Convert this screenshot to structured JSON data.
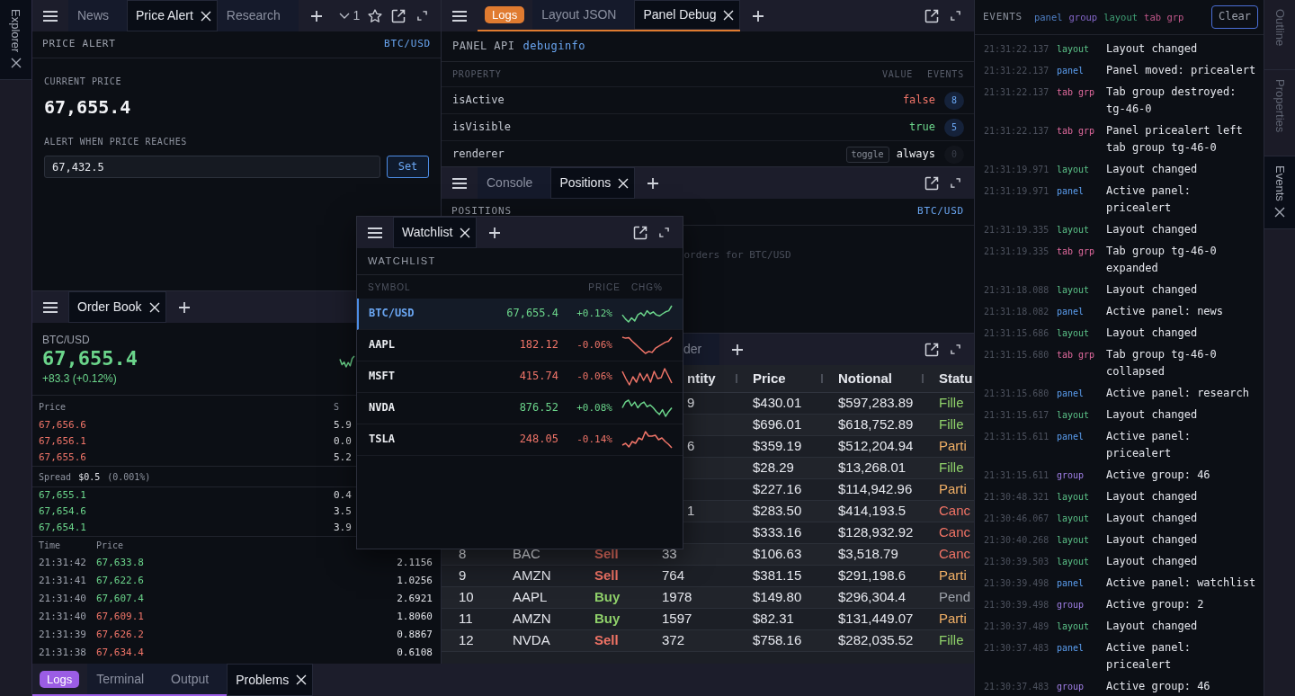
{
  "left_dock": {
    "tabs": [
      {
        "label": "Explorer",
        "selected": true
      }
    ]
  },
  "price_alert_group": {
    "tabs": [
      {
        "label": "News",
        "selected": false
      },
      {
        "label": "Price Alert",
        "selected": true
      },
      {
        "label": "Research",
        "selected": false
      }
    ],
    "hidden_tab_count": "1",
    "panel": {
      "title": "PRICE ALERT",
      "symbol": "BTC/USD",
      "current_price_label": "CURRENT PRICE",
      "current_price": "67,655.4",
      "alert_label": "ALERT WHEN PRICE REACHES",
      "alert_value": "67,432.5",
      "set_button": "Set"
    }
  },
  "order_book_group": {
    "tabs": [
      {
        "label": "Order Book",
        "selected": true
      }
    ],
    "panel": {
      "symbol": "BTC/USD",
      "price": "67,655.4",
      "change": "+83.3 (+0.12%)",
      "book_columns": [
        "Price",
        "S"
      ],
      "asks": [
        {
          "price": "67,656.6",
          "size": "5.9"
        },
        {
          "price": "67,656.1",
          "size": "0.0"
        },
        {
          "price": "67,655.6",
          "size": "5.2"
        }
      ],
      "spread": {
        "label": "Spread",
        "value": "$0.5",
        "percent": "(0.001%)"
      },
      "bids": [
        {
          "price": "67,655.1",
          "size": "0.4"
        },
        {
          "price": "67,654.6",
          "size": "3.5"
        },
        {
          "price": "67,654.1",
          "size": "3.9"
        }
      ],
      "trade_columns": [
        "Time",
        "Price"
      ],
      "trades": [
        {
          "time": "21:31:42",
          "price": "67,633.8",
          "size": "2.1156",
          "kind": "buy"
        },
        {
          "time": "21:31:41",
          "price": "67,622.6",
          "size": "1.0256",
          "kind": "buy"
        },
        {
          "time": "21:31:40",
          "price": "67,607.4",
          "size": "2.6921",
          "kind": "buy"
        },
        {
          "time": "21:31:40",
          "price": "67,609.1",
          "size": "1.8060",
          "kind": "sell"
        },
        {
          "time": "21:31:39",
          "price": "67,626.2",
          "size": "0.8867",
          "kind": "sell"
        },
        {
          "time": "21:31:38",
          "price": "67,634.4",
          "size": "0.6108",
          "kind": "sell"
        }
      ]
    }
  },
  "bottom_dock": {
    "tab_group": {
      "label": "Logs",
      "color": "#9b5de5",
      "tabs": [
        {
          "label": "Terminal",
          "selected": false
        },
        {
          "label": "Output",
          "selected": false
        }
      ]
    },
    "tabs": [
      {
        "label": "Problems",
        "selected": true
      }
    ]
  },
  "debug_group": {
    "tab_group": {
      "label": "Logs",
      "color": "#e07b30",
      "tabs": [
        {
          "label": "Layout JSON",
          "selected": false
        },
        {
          "label": "Panel Debug",
          "selected": true
        }
      ]
    },
    "panel": {
      "title": "PANEL API",
      "panel_id": "debuginfo",
      "columns": [
        "PROPERTY",
        "VALUE",
        "EVENTS"
      ],
      "properties": [
        {
          "name": "isActive",
          "value": "false",
          "kind": "negative",
          "events": "8",
          "events_active": true
        },
        {
          "name": "isVisible",
          "value": "true",
          "kind": "positive",
          "events": "5",
          "events_active": true
        },
        {
          "name": "renderer",
          "action": "toggle",
          "value": "always",
          "kind": "plain",
          "events": "0",
          "events_active": false
        }
      ]
    }
  },
  "positions_group": {
    "tabs": [
      {
        "label": "Console",
        "selected": false
      },
      {
        "label": "Positions",
        "selected": true
      }
    ],
    "panel": {
      "title": "POSITIONS",
      "symbol": "BTC/USD",
      "message": "orders for BTC/USD"
    }
  },
  "orders_group": {
    "tabs": [
      {
        "label": "der",
        "selected": false
      }
    ],
    "table": {
      "columns": [
        null,
        null,
        null,
        "ntity",
        "Price",
        "Notional",
        "Statu"
      ],
      "rows": [
        {
          "cells": [
            null,
            null,
            null,
            "9",
            "$430.01",
            "$597,283.89",
            {
              "text": "Fille",
              "kind": "filled"
            }
          ]
        },
        {
          "cells": [
            null,
            null,
            null,
            null,
            "$696.01",
            "$618,752.89",
            {
              "text": "Fille",
              "kind": "filled"
            }
          ]
        },
        {
          "cells": [
            null,
            null,
            null,
            "6",
            "$359.19",
            "$512,204.94",
            {
              "text": "Parti",
              "kind": "partial"
            }
          ]
        },
        {
          "cells": [
            null,
            null,
            null,
            null,
            "$28.29",
            "$13,268.01",
            {
              "text": "Fille",
              "kind": "filled"
            }
          ]
        },
        {
          "cells": [
            null,
            null,
            null,
            null,
            "$227.16",
            "$114,942.96",
            {
              "text": "Parti",
              "kind": "partial"
            }
          ]
        },
        {
          "cells": [
            null,
            null,
            null,
            "1",
            "$283.50",
            "$414,193.5",
            {
              "text": "Canc",
              "kind": "cancelled"
            }
          ]
        },
        {
          "cells": [
            null,
            null,
            null,
            null,
            "$333.16",
            "$128,932.92",
            {
              "text": "Canc",
              "kind": "cancelled"
            }
          ]
        },
        {
          "cells": [
            "8",
            "BAC",
            {
              "text": "Sell",
              "kind": "sell"
            },
            "33",
            "$106.63",
            "$3,518.79",
            {
              "text": "Canc",
              "kind": "cancelled"
            }
          ]
        },
        {
          "cells": [
            "9",
            "AMZN",
            {
              "text": "Sell",
              "kind": "sell"
            },
            "764",
            "$381.15",
            "$291,198.6",
            {
              "text": "Parti",
              "kind": "partial"
            }
          ]
        },
        {
          "cells": [
            "10",
            "AAPL",
            {
              "text": "Buy",
              "kind": "buy"
            },
            "1978",
            "$149.80",
            "$296,304.4",
            {
              "text": "Pend",
              "kind": "pending"
            }
          ]
        },
        {
          "cells": [
            "11",
            "AMZN",
            {
              "text": "Buy",
              "kind": "buy"
            },
            "1597",
            "$82.31",
            "$131,449.07",
            {
              "text": "Parti",
              "kind": "partial"
            }
          ]
        },
        {
          "cells": [
            "12",
            "NVDA",
            {
              "text": "Sell",
              "kind": "sell"
            },
            "372",
            "$758.16",
            "$282,035.52",
            {
              "text": "Fille",
              "kind": "filled"
            }
          ]
        }
      ]
    }
  },
  "watchlist_window": {
    "tabs": [
      {
        "label": "Watchlist",
        "selected": true
      }
    ],
    "panel": {
      "title": "WATCHLIST",
      "columns": [
        "SYMBOL",
        "PRICE",
        "CHG%"
      ],
      "rows": [
        {
          "symbol": "BTC/USD",
          "price": "67,655.4",
          "change": "+0.12%",
          "kind": "up",
          "selected": true
        },
        {
          "symbol": "AAPL",
          "price": "182.12",
          "change": "-0.06%",
          "kind": "down",
          "selected": false
        },
        {
          "symbol": "MSFT",
          "price": "415.74",
          "change": "-0.06%",
          "kind": "down",
          "selected": false
        },
        {
          "symbol": "NVDA",
          "price": "876.52",
          "change": "+0.08%",
          "kind": "up",
          "selected": false
        },
        {
          "symbol": "TSLA",
          "price": "248.05",
          "change": "-0.14%",
          "kind": "down",
          "selected": false
        }
      ]
    }
  },
  "events_panel": {
    "title": "EVENTS",
    "filters": [
      {
        "label": "panel",
        "color": "#4f7fc4"
      },
      {
        "label": "group",
        "color": "#8466c8"
      },
      {
        "label": "layout",
        "color": "#3f9f74"
      },
      {
        "label": "tab grp",
        "color": "#c2578a"
      }
    ],
    "clear_button": "Clear",
    "events": [
      {
        "time": "21:31:22.137",
        "type": "layout",
        "color": "#5cc489",
        "message": "Layout changed"
      },
      {
        "time": "21:31:22.137",
        "type": "panel",
        "color": "#5b9ef0",
        "message": "Panel moved: pricealert"
      },
      {
        "time": "21:31:22.137",
        "type": "tab grp",
        "color": "#e26a9e",
        "message": "Tab group destroyed: tg-46-0"
      },
      {
        "time": "21:31:22.137",
        "type": "tab grp",
        "color": "#e26a9e",
        "message": "Panel pricealert left tab group tg-46-0"
      },
      {
        "time": "21:31:19.971",
        "type": "layout",
        "color": "#5cc489",
        "message": "Layout changed"
      },
      {
        "time": "21:31:19.971",
        "type": "panel",
        "color": "#5b9ef0",
        "message": "Active panel: pricealert"
      },
      {
        "time": "21:31:19.335",
        "type": "layout",
        "color": "#5cc489",
        "message": "Layout changed"
      },
      {
        "time": "21:31:19.335",
        "type": "tab grp",
        "color": "#e26a9e",
        "message": "Tab group tg-46-0 expanded"
      },
      {
        "time": "21:31:18.088",
        "type": "layout",
        "color": "#5cc489",
        "message": "Layout changed"
      },
      {
        "time": "21:31:18.082",
        "type": "panel",
        "color": "#5b9ef0",
        "message": "Active panel: news"
      },
      {
        "time": "21:31:15.686",
        "type": "layout",
        "color": "#5cc489",
        "message": "Layout changed"
      },
      {
        "time": "21:31:15.680",
        "type": "tab grp",
        "color": "#e26a9e",
        "message": "Tab group tg-46-0 collapsed"
      },
      {
        "time": "21:31:15.680",
        "type": "panel",
        "color": "#5b9ef0",
        "message": "Active panel: research"
      },
      {
        "time": "21:31:15.617",
        "type": "layout",
        "color": "#5cc489",
        "message": "Layout changed"
      },
      {
        "time": "21:31:15.611",
        "type": "panel",
        "color": "#5b9ef0",
        "message": "Active panel: pricealert"
      },
      {
        "time": "21:31:15.611",
        "type": "group",
        "color": "#a07fe6",
        "message": "Active group: 46"
      },
      {
        "time": "21:30:48.321",
        "type": "layout",
        "color": "#5cc489",
        "message": "Layout changed"
      },
      {
        "time": "21:30:46.067",
        "type": "layout",
        "color": "#5cc489",
        "message": "Layout changed"
      },
      {
        "time": "21:30:40.268",
        "type": "layout",
        "color": "#5cc489",
        "message": "Layout changed"
      },
      {
        "time": "21:30:39.503",
        "type": "layout",
        "color": "#5cc489",
        "message": "Layout changed"
      },
      {
        "time": "21:30:39.498",
        "type": "panel",
        "color": "#5b9ef0",
        "message": "Active panel: watchlist"
      },
      {
        "time": "21:30:39.498",
        "type": "group",
        "color": "#a07fe6",
        "message": "Active group: 2"
      },
      {
        "time": "21:30:37.489",
        "type": "layout",
        "color": "#5cc489",
        "message": "Layout changed"
      },
      {
        "time": "21:30:37.483",
        "type": "panel",
        "color": "#5b9ef0",
        "message": "Active panel: pricealert"
      },
      {
        "time": "21:30:37.483",
        "type": "group",
        "color": "#a07fe6",
        "message": "Active group: 46"
      }
    ]
  },
  "right_dock": {
    "tabs": [
      {
        "label": "Outline",
        "selected": false
      },
      {
        "label": "Properties",
        "selected": false
      },
      {
        "label": "Events",
        "selected": true
      }
    ]
  }
}
